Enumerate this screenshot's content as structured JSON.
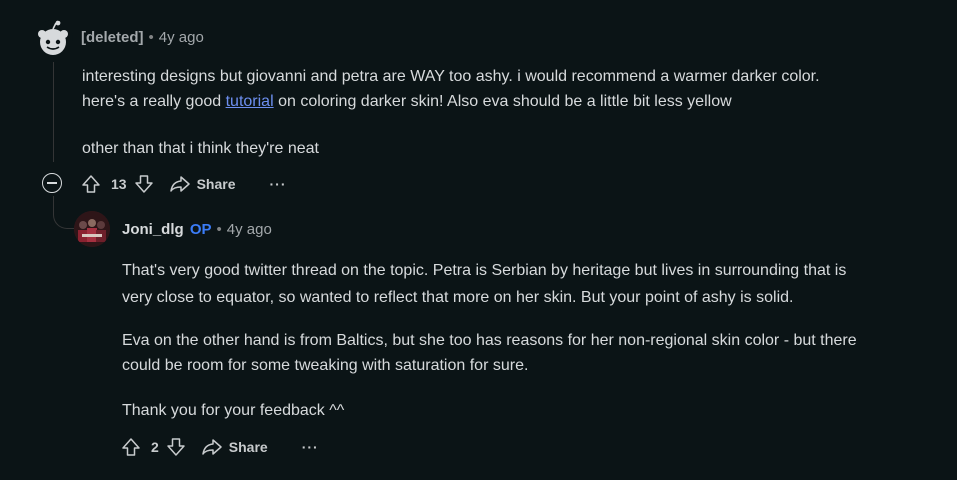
{
  "comment1": {
    "author": "[deleted]",
    "time": "4y ago",
    "paragraphs": {
      "p1_line1": "interesting designs but giovanni and petra are WAY too ashy. i would recommend a warmer darker color.",
      "p1_line2_before": "here's a really good ",
      "p1_link": "tutorial",
      "p1_line2_after": " on coloring darker skin! Also eva should be a little bit less yellow",
      "p2": "other than that i think they're neat"
    },
    "votes": "13",
    "share_label": "Share",
    "more_label": "···"
  },
  "comment2": {
    "author": "Joni_dlg",
    "op_badge": "OP",
    "time": "4y ago",
    "paragraphs": {
      "p1_line1": "That's very good twitter thread on the topic. Petra is Serbian by heritage but lives in surrounding that is",
      "p1_line2": "very close to equator, so wanted to reflect that more on her skin. But your point of ashy is solid.",
      "p2_line1": "Eva on the other hand is from Baltics, but she too has reasons for her non-regional skin color - but there",
      "p2_line2": "could be room for some tweaking with saturation for sure.",
      "p3": "Thank you for your feedback ^^"
    },
    "votes": "2",
    "share_label": "Share",
    "more_label": "···"
  },
  "colors": {
    "background": "#0b1416",
    "text": "#d7dadc",
    "link": "#6d8fef",
    "op_badge": "#3b7cf7"
  },
  "icons": [
    "deleted-user-avatar-icon",
    "upvote-icon",
    "downvote-icon",
    "share-icon",
    "more-options-icon",
    "collapse-icon"
  ]
}
